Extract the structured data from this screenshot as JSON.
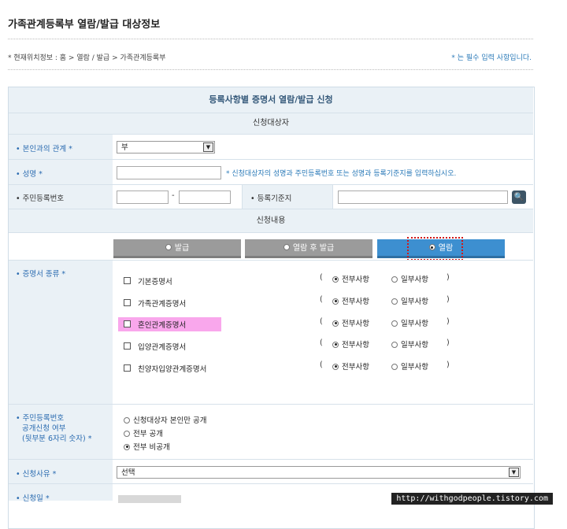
{
  "page_title": "가족관계등록부 열람/발급 대상정보",
  "location": "* 현재위치정보 : 홈 > 열람 / 발급 > 가족관계등록부",
  "required_note": "* 는 필수 입력 사항입니다.",
  "form": {
    "title": "등록사항별 증명서 열람/발급 신청",
    "target_section": "신청대상자",
    "relation": {
      "label": "• 본인과의 관계 *",
      "value": "부"
    },
    "name": {
      "label": "• 성명 *",
      "hint": "* 신청대상자의 성명과 주민등록번호 또는 성명과 등록기준지를 입력하십시오."
    },
    "rrn": {
      "label": "• 주민등록번호",
      "dash": "-"
    },
    "register_base": {
      "label": "• 등록기준지"
    },
    "content_section": "신청내용",
    "tabs": [
      {
        "label": "발급",
        "selected": false
      },
      {
        "label": "열람 후 발급",
        "selected": false
      },
      {
        "label": "열람",
        "selected": true
      }
    ],
    "cert_type": {
      "label": "• 증명서 종류 *",
      "options": [
        {
          "name": "기본증명서",
          "full": "전부사항",
          "partial": "일부사항"
        },
        {
          "name": "가족관계증명서",
          "full": "전부사항",
          "partial": "일부사항"
        },
        {
          "name": "혼인관계증명서",
          "full": "전부사항",
          "partial": "일부사항"
        },
        {
          "name": "입양관계증명서",
          "full": "전부사항",
          "partial": "일부사항"
        },
        {
          "name": "친양자입양관계증명서",
          "full": "전부사항",
          "partial": "일부사항"
        }
      ],
      "open_paren": "(",
      "close_paren": ")"
    },
    "rrn_disclosure": {
      "label_line1": "• 주민등록번호",
      "label_line2": "공개신청 여부",
      "label_line3": "(뒷부분 6자리 숫자) *",
      "options": [
        "신청대상자 본인만 공개",
        "전부 공개",
        "전부 비공개"
      ],
      "selected_index": 2
    },
    "reason": {
      "label": "• 신청사유 *",
      "value": "선택"
    },
    "apply_date": {
      "label": "• 신청일 *"
    }
  },
  "watermark": "http://withgodpeople.tistory.com",
  "colors": {
    "label_blue": "#2a6bb0",
    "tab_active": "#3d8fd0",
    "tab_inactive": "#9b9b9b",
    "highlight": "#f9a7ec",
    "focus": "#d01818"
  }
}
